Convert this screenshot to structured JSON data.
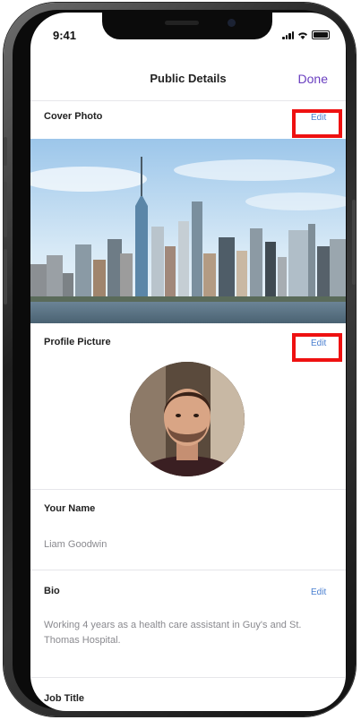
{
  "status_bar": {
    "time": "9:41"
  },
  "nav": {
    "title": "Public Details",
    "done_label": "Done"
  },
  "cover_photo": {
    "label": "Cover Photo",
    "edit_label": "Edit"
  },
  "profile_picture": {
    "label": "Profile Picture",
    "edit_label": "Edit"
  },
  "name": {
    "label": "Your Name",
    "value": "Liam Goodwin"
  },
  "bio": {
    "label": "Bio",
    "edit_label": "Edit",
    "text": "Working 4 years as a health care assistant in Guy's and St. Thomas Hospital."
  },
  "job_title": {
    "label": "Job Title"
  },
  "colors": {
    "accent": "#6a3fc0",
    "link": "#4a7fd0",
    "highlight": "#e11111"
  }
}
